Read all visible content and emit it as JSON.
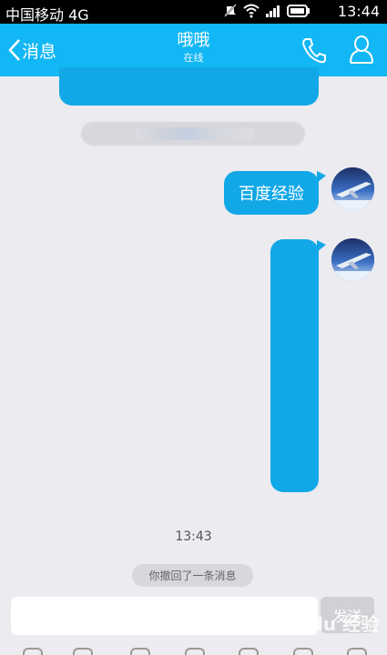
{
  "status_bar": {
    "carrier": "中国移动 4G",
    "time": "13:44"
  },
  "header": {
    "back_label": "消息",
    "title": "哦哦",
    "subtitle": "在线",
    "accent_color": "#12b7f5",
    "icons": [
      "back-chevron-icon",
      "phone-icon",
      "profile-icon"
    ]
  },
  "chat": {
    "messages": [
      {
        "text": "百度经验"
      },
      {
        "text": ""
      }
    ],
    "timestamp": "13:43",
    "recall_notice": "你撤回了一条消息",
    "bubble_color": "#12a8e8"
  },
  "input": {
    "value": "",
    "send_label": "发送"
  },
  "watermark": "Baidu 经验"
}
